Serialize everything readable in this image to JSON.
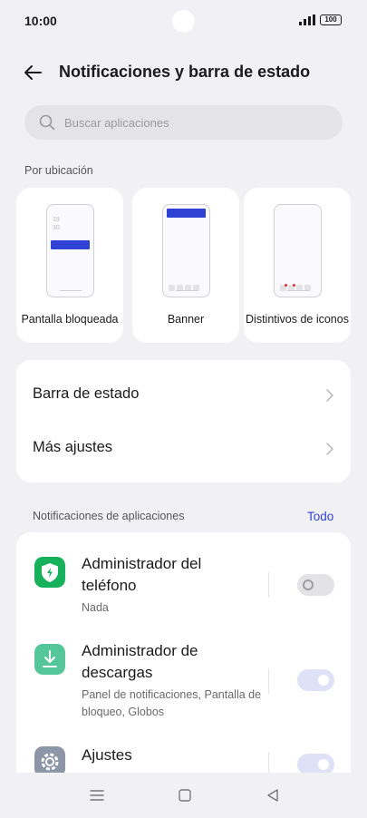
{
  "status_bar": {
    "time": "10:00",
    "battery": "100"
  },
  "header": {
    "title": "Notificaciones y barra de estado"
  },
  "search": {
    "placeholder": "Buscar aplicaciones"
  },
  "by_location": {
    "label": "Por ubicación",
    "cards": [
      {
        "label": "Pantalla bloqueada",
        "clock_time": "19\n30"
      },
      {
        "label": "Banner"
      },
      {
        "label": "Distintivos de iconos"
      }
    ]
  },
  "settings_rows": [
    {
      "label": "Barra de estado"
    },
    {
      "label": "Más ajustes"
    }
  ],
  "app_notifications": {
    "label": "Notificaciones de aplicaciones",
    "filter": "Todo",
    "apps": [
      {
        "name": "Administrador del teléfono",
        "detail": "Nada",
        "enabled": false,
        "icon": "phone-manager-icon",
        "color": "#16b15a"
      },
      {
        "name": "Administrador de descargas",
        "detail": "Panel de notificaciones, Pantalla de bloqueo, Globos",
        "enabled": true,
        "icon": "download-manager-icon",
        "color": "#55c69a"
      },
      {
        "name": "Ajustes",
        "detail": "",
        "enabled": true,
        "icon": "settings-icon",
        "color": "#8c96a6"
      }
    ]
  },
  "colors": {
    "accent": "#3041d6",
    "background": "#f1f1f3",
    "toggle_on": "#dfe1f7"
  }
}
